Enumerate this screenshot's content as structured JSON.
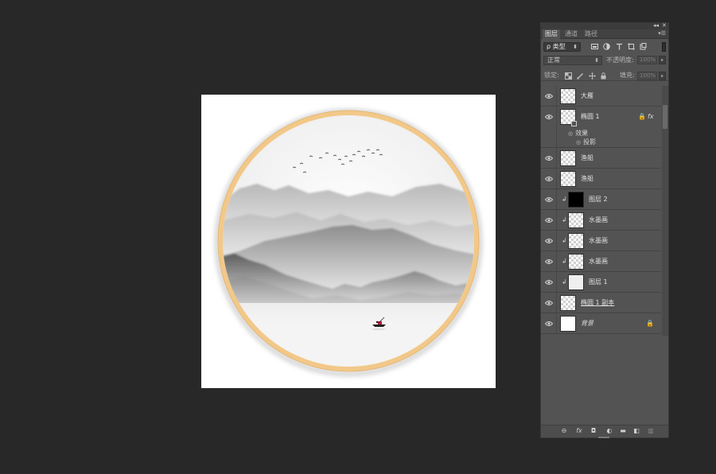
{
  "panel": {
    "collapse_glyph": "◂◂",
    "close_glyph": "✕",
    "menu_glyph": "▾☰",
    "tabs": [
      {
        "label": "图层",
        "active": true
      },
      {
        "label": "通道",
        "active": false
      },
      {
        "label": "路径",
        "active": false
      }
    ],
    "filter": {
      "glyph": "ρ",
      "label": "类型",
      "caret": "⬍"
    },
    "filter_icons": [
      "image-filter-icon",
      "adjustment-filter-icon",
      "type-filter-icon",
      "shape-filter-icon",
      "smart-object-filter-icon"
    ],
    "blend": {
      "value": "正常",
      "caret": "⬍"
    },
    "opacity": {
      "label": "不透明度:",
      "value": "100%"
    },
    "lock_label": "锁定:",
    "fill": {
      "label": "填充:",
      "value": "100%"
    },
    "spin_glyph": "▸",
    "layers": [
      {
        "name": "大雁",
        "thumb": "checker"
      },
      {
        "name": "椭圆 1",
        "thumb": "checker",
        "lock": "🔒",
        "fx": "fx",
        "effects_label": "效果",
        "effect_items": [
          "投影"
        ]
      },
      {
        "name": "渔船",
        "thumb": "checker"
      },
      {
        "name": "渔船",
        "thumb": "checker"
      },
      {
        "name": "图层 2",
        "thumb": "black",
        "clip": "↲"
      },
      {
        "name": "水墨画",
        "thumb": "checker",
        "clip": "↲"
      },
      {
        "name": "水墨画",
        "thumb": "checker",
        "clip": "↲"
      },
      {
        "name": "水墨画",
        "thumb": "checker",
        "clip": "↲"
      },
      {
        "name": "图层 1",
        "thumb": "light",
        "clip": "↲"
      },
      {
        "name": "椭圆 1 副本",
        "thumb": "checker"
      },
      {
        "name": "背景",
        "thumb": "white",
        "lock": "🔒"
      }
    ],
    "bottom_icons": [
      {
        "name": "link-layers-icon",
        "glyph": "⊖"
      },
      {
        "name": "fx-icon",
        "glyph": "fx"
      },
      {
        "name": "add-mask-icon",
        "glyph": "◘"
      },
      {
        "name": "adjustment-layer-icon",
        "glyph": "◐"
      },
      {
        "name": "group-folder-icon",
        "glyph": "▬"
      },
      {
        "name": "new-layer-icon",
        "glyph": "◧"
      },
      {
        "name": "delete-layer-icon",
        "glyph": "▥"
      }
    ]
  },
  "colors": {
    "ring": "#f2c889",
    "workspace": "#282828",
    "panel": "#535353"
  }
}
